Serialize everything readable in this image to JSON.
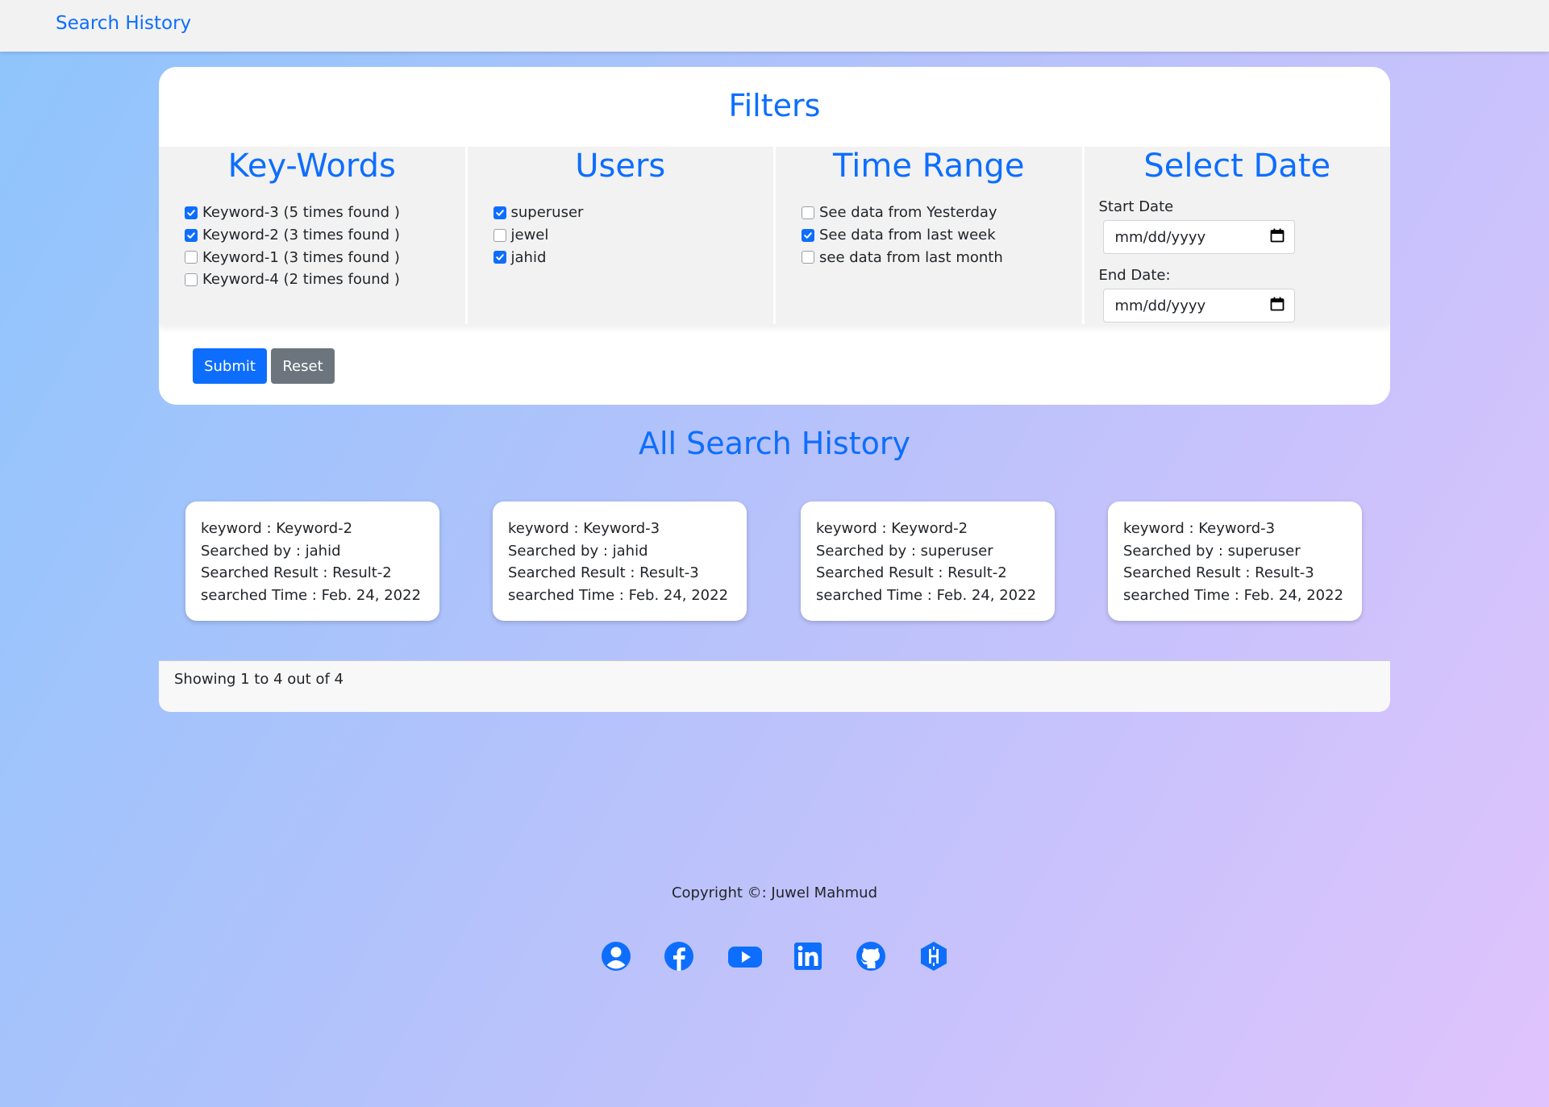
{
  "nav": {
    "brand": "Search History"
  },
  "filters": {
    "title": "Filters",
    "keywords": {
      "title": "Key-Words",
      "items": [
        {
          "label": "Keyword-3 (5 times found )",
          "checked": true
        },
        {
          "label": "Keyword-2 (3 times found )",
          "checked": true
        },
        {
          "label": "Keyword-1 (3 times found )",
          "checked": false
        },
        {
          "label": "Keyword-4 (2 times found )",
          "checked": false
        }
      ]
    },
    "users": {
      "title": "Users",
      "items": [
        {
          "label": "superuser",
          "checked": true
        },
        {
          "label": "jewel",
          "checked": false
        },
        {
          "label": "jahid",
          "checked": true
        }
      ]
    },
    "time_range": {
      "title": "Time Range",
      "items": [
        {
          "label": "See data from Yesterday",
          "checked": false
        },
        {
          "label": "See data from last week",
          "checked": true
        },
        {
          "label": "see data from last month",
          "checked": false
        }
      ]
    },
    "select_date": {
      "title": "Select Date",
      "start_label": "Start Date",
      "start_placeholder": "mm/dd/yyyy",
      "end_label": "End Date:",
      "end_placeholder": "mm/dd/yyyy"
    },
    "submit_label": "Submit",
    "reset_label": "Reset"
  },
  "history": {
    "title": "All Search History",
    "cards": [
      {
        "keyword": "keyword : Keyword-2",
        "searched_by": "Searched by : jahid",
        "result": "Searched Result : Result-2",
        "time": "searched Time : Feb. 24, 2022"
      },
      {
        "keyword": "keyword : Keyword-3",
        "searched_by": "Searched by : jahid",
        "result": "Searched Result : Result-3",
        "time": "searched Time : Feb. 24, 2022"
      },
      {
        "keyword": "keyword : Keyword-2",
        "searched_by": "Searched by : superuser",
        "result": "Searched Result : Result-2",
        "time": "searched Time : Feb. 24, 2022"
      },
      {
        "keyword": "keyword : Keyword-3",
        "searched_by": "Searched by : superuser",
        "result": "Searched Result : Result-3",
        "time": "searched Time : Feb. 24, 2022"
      }
    ],
    "pagination_text": "Showing 1 to 4 out of 4"
  },
  "footer": {
    "copyright": "Copyright ©: Juwel Mahmud",
    "socials": [
      "profile-icon",
      "facebook-icon",
      "youtube-icon",
      "linkedin-icon",
      "github-icon",
      "hashnode-icon"
    ]
  },
  "colors": {
    "accent": "#0d6efd",
    "secondary": "#6c757d",
    "panel": "#f2f2f2"
  }
}
